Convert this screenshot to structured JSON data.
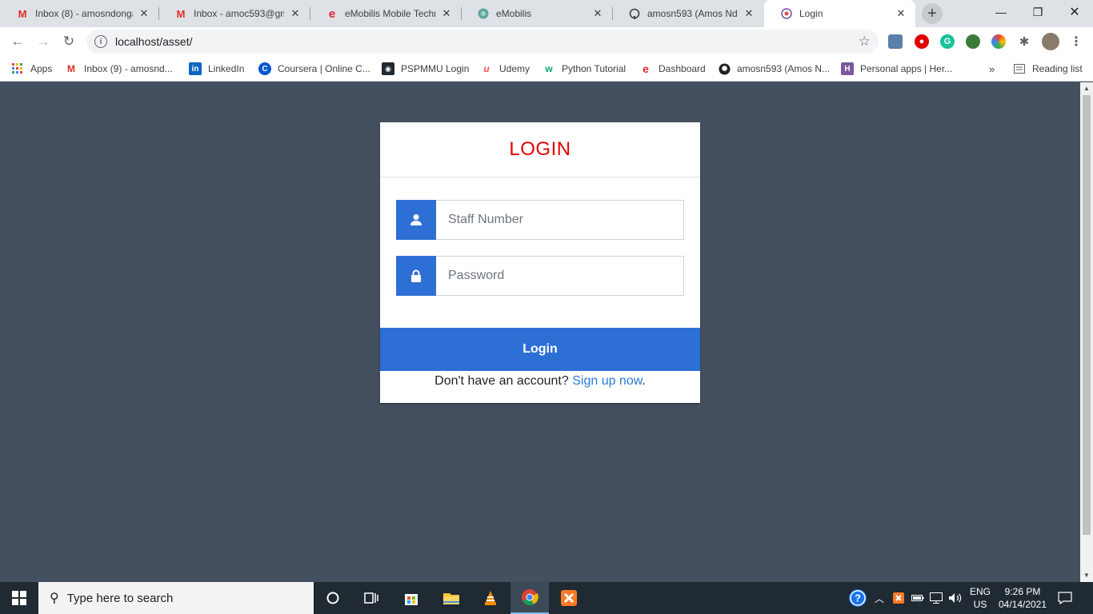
{
  "browser": {
    "tabs": [
      {
        "title": "Inbox (8) - amosndonga",
        "favicon": "gmail-icon"
      },
      {
        "title": "Inbox - amoc593@gma",
        "favicon": "gmail-icon"
      },
      {
        "title": "eMobilis Mobile Techno",
        "favicon": "emobilis-icon"
      },
      {
        "title": "eMobilis",
        "favicon": "globe-icon"
      },
      {
        "title": "amosn593 (Amos Ndon",
        "favicon": "github-icon"
      },
      {
        "title": "Login",
        "favicon": "login-favicon"
      }
    ],
    "url": "localhost/asset/",
    "bookmarks": [
      {
        "label": "Apps"
      },
      {
        "label": "Inbox (9) - amosnd..."
      },
      {
        "label": "LinkedIn"
      },
      {
        "label": "Coursera | Online C..."
      },
      {
        "label": "PSPMMU Login"
      },
      {
        "label": "Udemy"
      },
      {
        "label": "Python Tutorial"
      },
      {
        "label": "Dashboard"
      },
      {
        "label": "amosn593 (Amos N..."
      },
      {
        "label": "Personal apps | Her..."
      }
    ],
    "bookmarks_overflow": "»",
    "reading_list": "Reading list"
  },
  "login": {
    "title": "LOGIN",
    "staff_placeholder": "Staff Number",
    "password_placeholder": "Password",
    "button_label": "Login",
    "signup_prompt": "Don't have an account?",
    "signup_link": "Sign up now",
    "signup_suffix": "."
  },
  "taskbar": {
    "search_placeholder": "Type here to search",
    "language": "ENG",
    "region": "US",
    "time": "9:26 PM",
    "date": "04/14/2021"
  },
  "colors": {
    "page_background": "#44505f",
    "accent_blue": "#2e6fd6",
    "title_red": "#e20000",
    "link_blue": "#2a7bd6"
  }
}
